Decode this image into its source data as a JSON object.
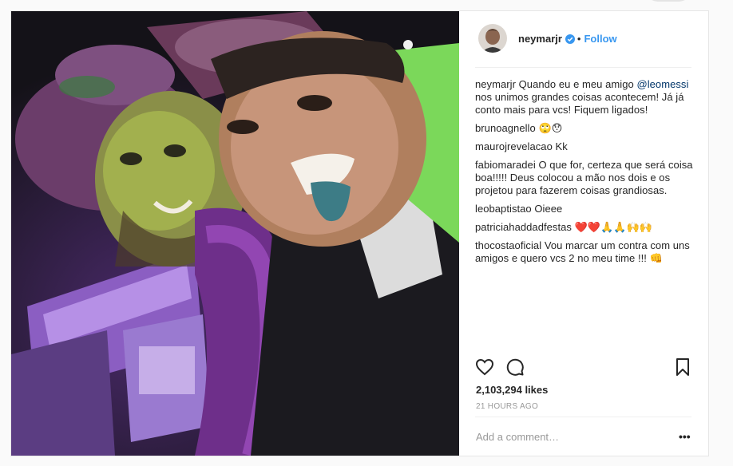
{
  "post": {
    "username": "neymarjr",
    "follow_label": "Follow",
    "separator": "•"
  },
  "caption": {
    "user": "neymarjr",
    "text_before": "Quando eu e meu amigo ",
    "mention": "@leomessi",
    "text_after": " nos unimos grandes coisas acontecem! Já já conto mais para vcs! Fiquem ligados!"
  },
  "comments": [
    {
      "user": "brunoagnello",
      "text": "🙄😯"
    },
    {
      "user": "maurojrevelacao",
      "text": "Kk"
    },
    {
      "user": "fabiomaradei",
      "text": "O que for, certeza que será coisa boa!!!!! Deus colocou a mão nos dois e os projetou para fazerem coisas grandiosas."
    },
    {
      "user": "leobaptistao",
      "text": "Oieee"
    },
    {
      "user": "patriciahaddadfestas",
      "text": "❤️❤️🙏🙏🙌🙌"
    },
    {
      "user": "thocostaoficial",
      "text": "Vou marcar um contra com uns amigos e quero vcs 2 no meu time !!! 👊"
    }
  ],
  "likes_text": "2,103,294 likes",
  "timestamp": "21 HOURS AGO",
  "add_comment_placeholder": "Add a comment…",
  "more_label": "•••",
  "icons": {
    "like": "heart-icon",
    "comment": "speech-bubble-icon",
    "save": "bookmark-icon",
    "verified": "verified-badge-icon"
  },
  "colors": {
    "accent": "#3897f0",
    "text": "#262626",
    "muted": "#999999",
    "verified": "#3897f0"
  }
}
